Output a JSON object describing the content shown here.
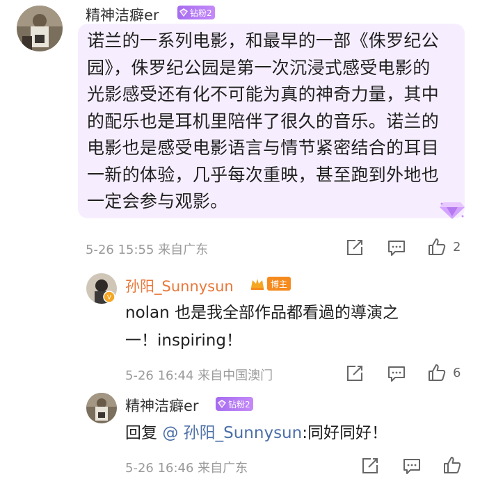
{
  "comments": [
    {
      "user": "精神洁癖er",
      "badge": "钻粉2",
      "content": "诺兰的一系列电影，和最早的一部《侏罗纪公园》，侏罗纪公园是第一次沉浸式感受电影的光影感受还有化不可能为真的神奇力量，其中的配乐也是耳机里陪伴了很久的音乐。诺兰的电影也是感受电影语言与情节紧密结合的耳目一新的体验，几乎每次重映，甚至跑到外地也一定会参与观影。",
      "lines": [
        "诺兰的一系列电影，和最早的一部《侏罗纪公",
        "园》，侏罗纪公园是第一次沉浸式感受电影的",
        "光影感受还有化不可能为真的神奇力量，其中",
        "的配乐也是耳机里陪伴了很久的音乐。诺兰的",
        "电影也是感受电影语言与情节紧密结合的耳目",
        "一新的体验，几乎每次重映，甚至跑到外地也",
        "一定会参与观影。"
      ],
      "meta": "5-26 15:55 来自广东",
      "likes": "2"
    },
    {
      "user": "孙阳_Sunnysun",
      "badge": "博主",
      "lines": [
        "nolan 也是我全部作品都看過的導演之",
        "一！inspiring！"
      ],
      "meta": "5-26 16:44 来自中国澳门",
      "likes": "6"
    },
    {
      "user": "精神洁癖er",
      "badge": "钻粉2",
      "reply_prefix": "回复",
      "mention": "@ 孙阳_Sunnysun",
      "reply_text": ":同好同好！",
      "meta": "5-26 16:46 来自广东",
      "likes": ""
    }
  ],
  "colors": {
    "bubble": "#f6eefe",
    "badge_purple": "#b07af4",
    "host_orange": "#f58b1f",
    "author_name": "#e8783a",
    "mention": "#4c6fa8",
    "meta_gray": "#9a9a9a"
  },
  "icons": [
    "avatar-icon",
    "diamond-fan-icon",
    "host-crown-icon",
    "share-icon",
    "comment-icon",
    "like-icon",
    "diamond-gem-icon"
  ]
}
